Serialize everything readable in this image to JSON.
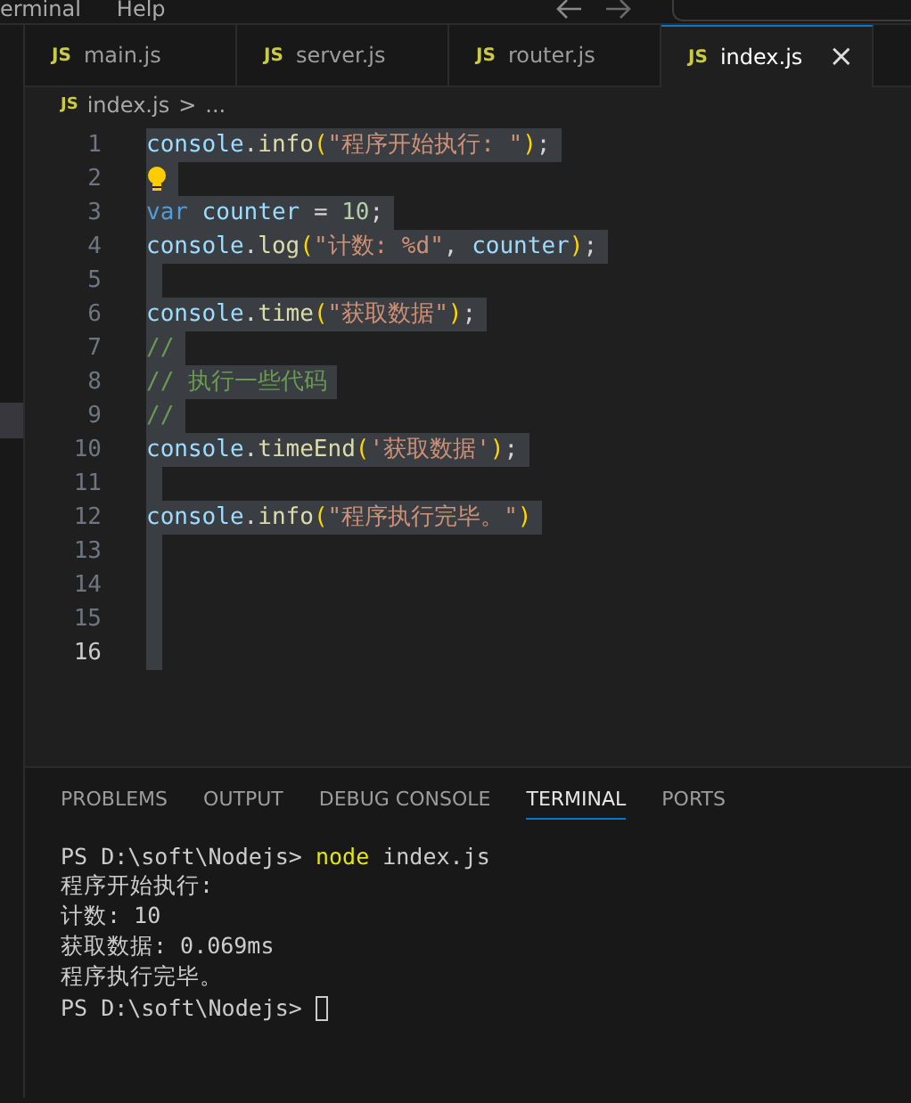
{
  "menu": [
    "erminal",
    "Help"
  ],
  "tabs": [
    {
      "label": "main.js",
      "icon": "JS",
      "selected": false
    },
    {
      "label": "server.js",
      "icon": "JS",
      "selected": false
    },
    {
      "label": "router.js",
      "icon": "JS",
      "selected": false
    },
    {
      "label": "index.js",
      "icon": "JS",
      "selected": true,
      "close": "×"
    }
  ],
  "breadcrumb": {
    "icon": "JS",
    "file": "index.js",
    "sep": ">",
    "rest": "..."
  },
  "lines": [
    {
      "number": "1",
      "current": false,
      "selected": true,
      "tokens": [
        {
          "text": "console",
          "kind": "var"
        },
        {
          "text": ".",
          "kind": "punct"
        },
        {
          "text": "info",
          "kind": "fn"
        },
        {
          "text": "(",
          "kind": "bracket"
        },
        {
          "text": "\"程序开始执行: \"",
          "kind": "string"
        },
        {
          "text": ")",
          "kind": "bracket"
        },
        {
          "text": ";",
          "kind": "punct"
        }
      ]
    },
    {
      "number": "2",
      "current": false,
      "selected": true,
      "bulb": true
    },
    {
      "number": "3",
      "current": false,
      "selected": true,
      "tokens": [
        {
          "text": "var",
          "kind": "keyword"
        },
        {
          "text": " counter ",
          "kind": "var"
        },
        {
          "text": "=",
          "kind": "punct"
        },
        {
          "text": " 10",
          "kind": "number"
        },
        {
          "text": ";",
          "kind": "punct"
        }
      ]
    },
    {
      "number": "4",
      "current": false,
      "selected": true,
      "tokens": [
        {
          "text": "console",
          "kind": "var"
        },
        {
          "text": ".",
          "kind": "punct"
        },
        {
          "text": "log",
          "kind": "fn"
        },
        {
          "text": "(",
          "kind": "bracket"
        },
        {
          "text": "\"计数: %d\"",
          "kind": "string"
        },
        {
          "text": ", ",
          "kind": "punct"
        },
        {
          "text": "counter",
          "kind": "var"
        },
        {
          "text": ")",
          "kind": "bracket"
        },
        {
          "text": ";",
          "kind": "punct"
        }
      ]
    },
    {
      "number": "5",
      "current": false,
      "selected": true
    },
    {
      "number": "6",
      "current": false,
      "selected": true,
      "tokens": [
        {
          "text": "console",
          "kind": "var"
        },
        {
          "text": ".",
          "kind": "punct"
        },
        {
          "text": "time",
          "kind": "fn"
        },
        {
          "text": "(",
          "kind": "bracket"
        },
        {
          "text": "\"获取数据\"",
          "kind": "string"
        },
        {
          "text": ")",
          "kind": "bracket"
        },
        {
          "text": ";",
          "kind": "punct"
        }
      ]
    },
    {
      "number": "7",
      "current": false,
      "selected": true,
      "tokens": [
        {
          "text": "//",
          "kind": "comment"
        }
      ]
    },
    {
      "number": "8",
      "current": false,
      "selected": true,
      "tokens": [
        {
          "text": "// 执行一些代码",
          "kind": "comment"
        }
      ]
    },
    {
      "number": "9",
      "current": false,
      "selected": true,
      "tokens": [
        {
          "text": "//",
          "kind": "comment"
        }
      ]
    },
    {
      "number": "10",
      "current": false,
      "selected": true,
      "tokens": [
        {
          "text": "console",
          "kind": "var"
        },
        {
          "text": ".",
          "kind": "punct"
        },
        {
          "text": "timeEnd",
          "kind": "fn"
        },
        {
          "text": "(",
          "kind": "bracket"
        },
        {
          "text": "'获取数据'",
          "kind": "string"
        },
        {
          "text": ")",
          "kind": "bracket"
        },
        {
          "text": ";",
          "kind": "punct"
        }
      ]
    },
    {
      "number": "11",
      "current": false,
      "selected": true
    },
    {
      "number": "12",
      "current": false,
      "selected": true,
      "tokens": [
        {
          "text": "console",
          "kind": "var"
        },
        {
          "text": ".",
          "kind": "punct"
        },
        {
          "text": "info",
          "kind": "fn"
        },
        {
          "text": "(",
          "kind": "bracket"
        },
        {
          "text": "\"程序执行完毕。\"",
          "kind": "string"
        },
        {
          "text": ")",
          "kind": "bracket"
        }
      ]
    },
    {
      "number": "13",
      "current": false,
      "selected": true
    },
    {
      "number": "14",
      "current": false,
      "selected": true
    },
    {
      "number": "15",
      "current": false,
      "selected": true
    },
    {
      "number": "16",
      "current": true,
      "selected": true
    }
  ],
  "panel_tabs": [
    {
      "label": "PROBLEMS",
      "selected": false
    },
    {
      "label": "OUTPUT",
      "selected": false
    },
    {
      "label": "DEBUG CONSOLE",
      "selected": false
    },
    {
      "label": "TERMINAL",
      "selected": true
    },
    {
      "label": "PORTS",
      "selected": false
    }
  ],
  "terminal": [
    {
      "tokens": [
        {
          "text": "PS D:\\soft\\Nodejs> ",
          "kind": "plain"
        },
        {
          "text": "node",
          "kind": "command"
        },
        {
          "text": " index.js",
          "kind": "plain"
        }
      ]
    },
    {
      "tokens": [
        {
          "text": "程序开始执行:",
          "kind": "plain"
        }
      ]
    },
    {
      "tokens": [
        {
          "text": "计数: 10",
          "kind": "plain"
        }
      ]
    },
    {
      "tokens": [
        {
          "text": "获取数据: 0.069ms",
          "kind": "plain"
        }
      ]
    },
    {
      "tokens": [
        {
          "text": "程序执行完毕。",
          "kind": "plain"
        }
      ]
    },
    {
      "tokens": [
        {
          "text": "PS D:\\soft\\Nodejs> ",
          "kind": "plain"
        }
      ],
      "cursor": true
    }
  ]
}
